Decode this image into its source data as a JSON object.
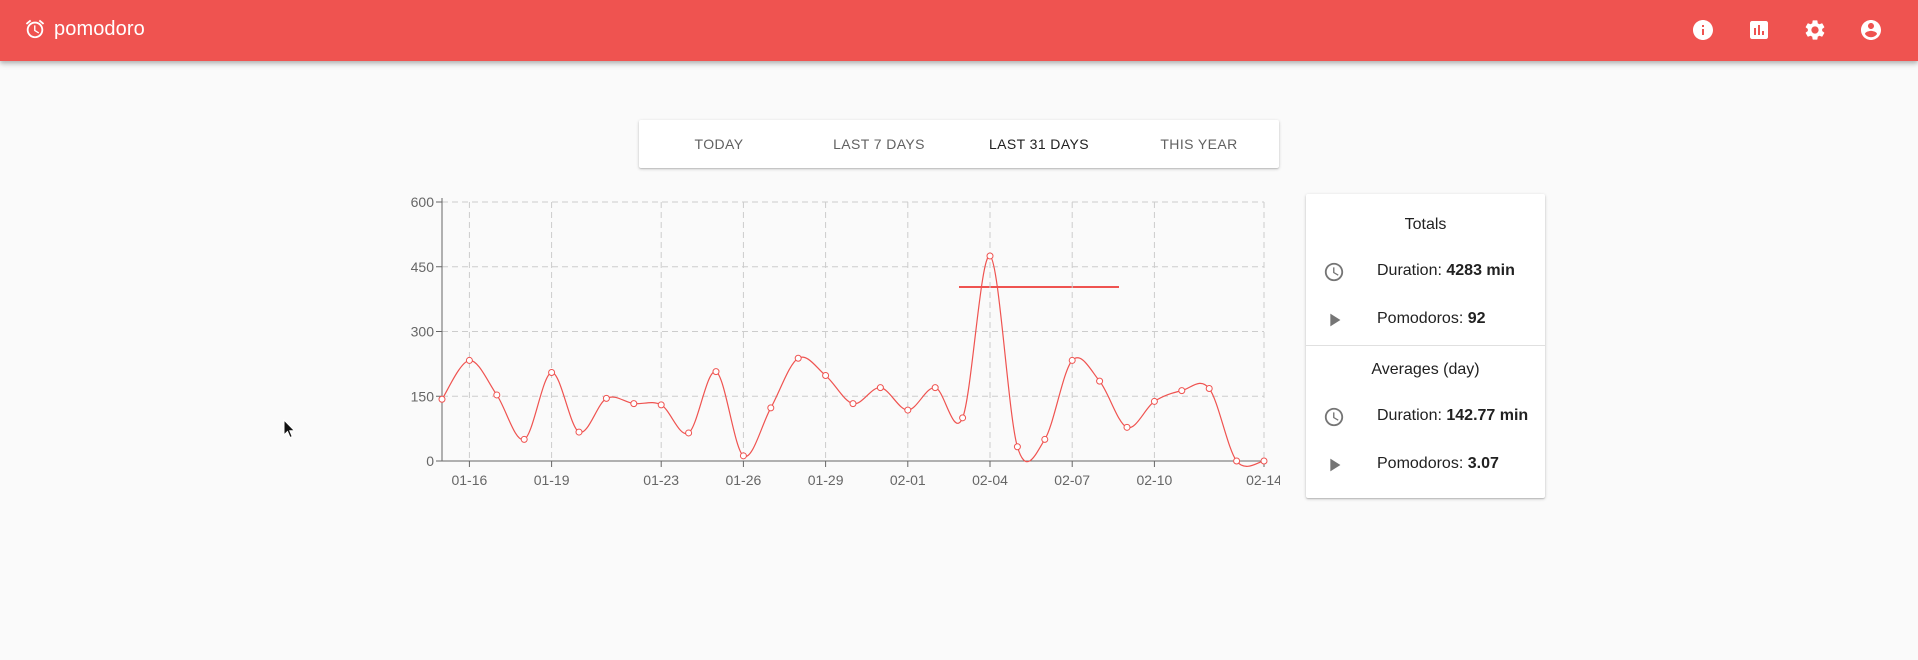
{
  "app": {
    "title": "pomodoro",
    "brand_icon": "alarm-clock-icon",
    "accent_color": "#ef5350"
  },
  "header_icons": [
    {
      "name": "info-icon"
    },
    {
      "name": "bar-chart-icon"
    },
    {
      "name": "gear-icon"
    },
    {
      "name": "account-circle-icon"
    }
  ],
  "tabs": [
    {
      "label": "TODAY",
      "active": false
    },
    {
      "label": "LAST 7 DAYS",
      "active": false
    },
    {
      "label": "LAST 31 DAYS",
      "active": true
    },
    {
      "label": "THIS YEAR",
      "active": false
    }
  ],
  "chart_data": {
    "type": "line",
    "title": "",
    "xlabel": "",
    "ylabel": "",
    "ylim": [
      0,
      600
    ],
    "yticks": [
      0,
      150,
      300,
      450,
      600
    ],
    "xtick_labels": [
      "01-16",
      "01-19",
      "01-23",
      "01-26",
      "01-29",
      "02-01",
      "02-04",
      "02-07",
      "02-10",
      "02-14"
    ],
    "grid": true,
    "line_color": "#ef5350",
    "series": [
      {
        "x": [
          "01-15",
          "01-16",
          "01-17",
          "01-18",
          "01-19",
          "01-20",
          "01-21",
          "01-22",
          "01-23",
          "01-24",
          "01-25",
          "01-26",
          "01-27",
          "01-28",
          "01-29",
          "01-30",
          "01-31",
          "02-01",
          "02-02",
          "02-03",
          "02-04",
          "02-05",
          "02-06",
          "02-07",
          "02-08",
          "02-09",
          "02-10",
          "02-11",
          "02-12",
          "02-13",
          "02-14"
        ],
        "values": [
          143,
          233,
          153,
          50,
          205,
          67,
          145,
          133,
          130,
          65,
          207,
          12,
          123,
          238,
          198,
          133,
          170,
          118,
          170,
          100,
          475,
          33,
          50,
          233,
          185,
          78,
          138,
          163,
          168,
          0,
          0
        ]
      }
    ]
  },
  "totals": {
    "heading": "Totals",
    "duration_label": "Duration: ",
    "duration_value": "4283 min",
    "pomodoros_label": "Pomodoros: ",
    "pomodoros_value": "92"
  },
  "averages": {
    "heading": "Averages (day)",
    "duration_label": "Duration: ",
    "duration_value": "142.77 min",
    "pomodoros_label": "Pomodoros: ",
    "pomodoros_value": "3.07"
  }
}
